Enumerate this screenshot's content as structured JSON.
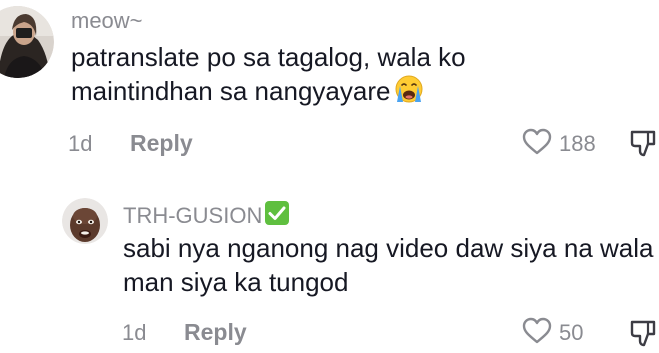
{
  "comments": [
    {
      "username": "meow~",
      "text": "patranslate po sa tagalog, wala ko maintindhan sa nangyayare",
      "emoji_icon": "loudly-crying-face-icon",
      "age": "1d",
      "reply_label": "Reply",
      "likes": "188"
    }
  ],
  "replies": [
    {
      "username": "TRH-GUSION",
      "badge_icon": "check-mark-button-icon",
      "text": "sabi nya nganong nag video daw siya na wala man siya ka tungod",
      "age": "1d",
      "reply_label": "Reply",
      "likes": "50"
    }
  ],
  "colors": {
    "text": "#161823",
    "muted": "#8a8b91",
    "badge": "#5fbf3f"
  }
}
